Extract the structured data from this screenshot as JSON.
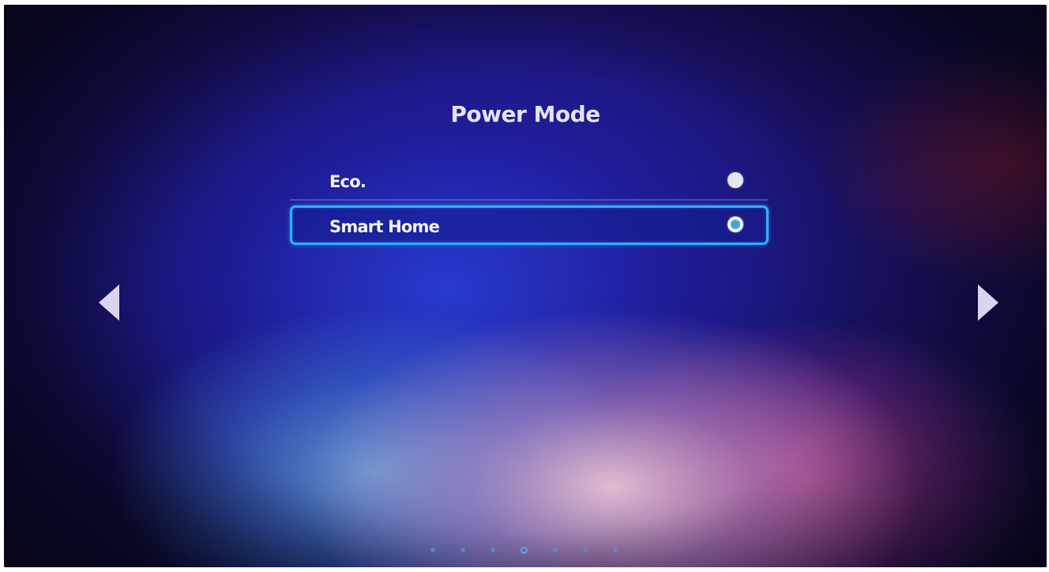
{
  "screen": {
    "title": "Power Mode"
  },
  "options": [
    {
      "label": "Eco.",
      "selected": false
    },
    {
      "label": "Smart Home",
      "selected": true
    }
  ],
  "navigation": {
    "left_arrow_icon": "triangle-left-icon",
    "right_arrow_icon": "triangle-right-icon"
  },
  "pagination": {
    "total_pages": 7,
    "current_page": 4
  },
  "colors": {
    "focus_border": "#2fb0ff",
    "selected_radio_dot": "#3fa6e6",
    "text": "#f4f4fb"
  }
}
